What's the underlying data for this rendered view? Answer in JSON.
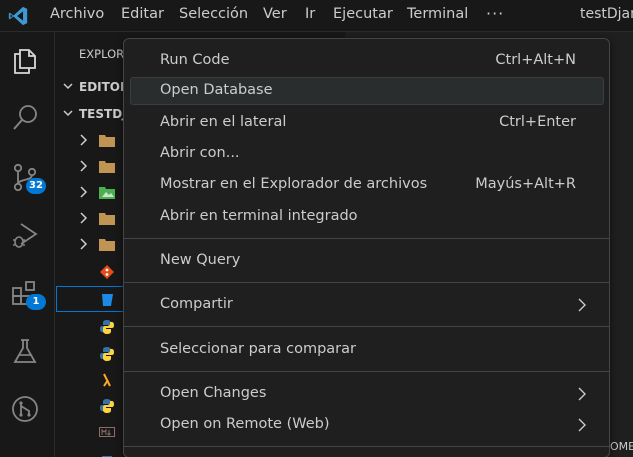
{
  "titlebar": {
    "menus": [
      "Archivo",
      "Editar",
      "Selección",
      "Ver",
      "Ir",
      "Ejecutar",
      "Terminal"
    ],
    "more": "···",
    "window_title": "testDjan"
  },
  "activitybar": {
    "icons": [
      "files-icon",
      "search-icon",
      "source-control-icon",
      "run-debug-icon",
      "extensions-icon",
      "testing-icon",
      "remote-icon"
    ],
    "source_control_badge": "32",
    "extensions_badge": "1"
  },
  "sidebar": {
    "title": "EXPLOR",
    "sections": [
      "EDITOR",
      "TESTDJ"
    ]
  },
  "context_menu": {
    "groups": [
      [
        {
          "label": "Run Code",
          "shortcut": "Ctrl+Alt+N"
        },
        {
          "label": "Open Database",
          "shortcut": ""
        },
        {
          "label": "Abrir en el lateral",
          "shortcut": "Ctrl+Enter"
        },
        {
          "label": "Abrir con...",
          "shortcut": ""
        },
        {
          "label": "Mostrar en el Explorador de archivos",
          "shortcut": "Mayús+Alt+R"
        },
        {
          "label": "Abrir en terminal integrado",
          "shortcut": ""
        }
      ],
      [
        {
          "label": "New Query",
          "shortcut": ""
        }
      ],
      [
        {
          "label": "Compartir",
          "shortcut": "",
          "submenu": true
        }
      ],
      [
        {
          "label": "Seleccionar para comparar",
          "shortcut": ""
        }
      ],
      [
        {
          "label": "Open Changes",
          "shortcut": "",
          "submenu": true
        },
        {
          "label": "Open on Remote (Web)",
          "shortcut": "",
          "submenu": true
        }
      ]
    ],
    "hovered": "Open Database"
  },
  "status": {
    "right_fragment": "OMEN"
  },
  "colors": {
    "accent": "#0078d4",
    "menu_bg": "#1f1f1f",
    "chrome_bg": "#181818"
  }
}
